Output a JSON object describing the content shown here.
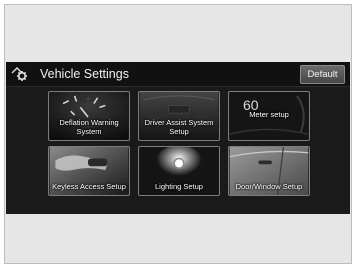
{
  "header": {
    "title": "Vehicle Settings",
    "default_label": "Default",
    "home_icon": "home-gear-icon"
  },
  "tiles": [
    {
      "label": "Deflation Warning System",
      "icon": "tire-pressure-gauge-image"
    },
    {
      "label": "Driver Assist System Setup",
      "icon": "steering-dashboard-image"
    },
    {
      "label": "Meter setup",
      "icon": "speedometer-image",
      "meter_value": "60"
    },
    {
      "label": "Keyless Access Setup",
      "icon": "key-fob-hand-image"
    },
    {
      "label": "Lighting Setup",
      "icon": "headlight-image"
    },
    {
      "label": "Door/Window Setup",
      "icon": "car-door-image"
    }
  ],
  "colors": {
    "screen_bg": "#1a1a1a",
    "header_bg": "#111111",
    "tile_border": "#7d7d7d",
    "text": "#ffffff"
  }
}
